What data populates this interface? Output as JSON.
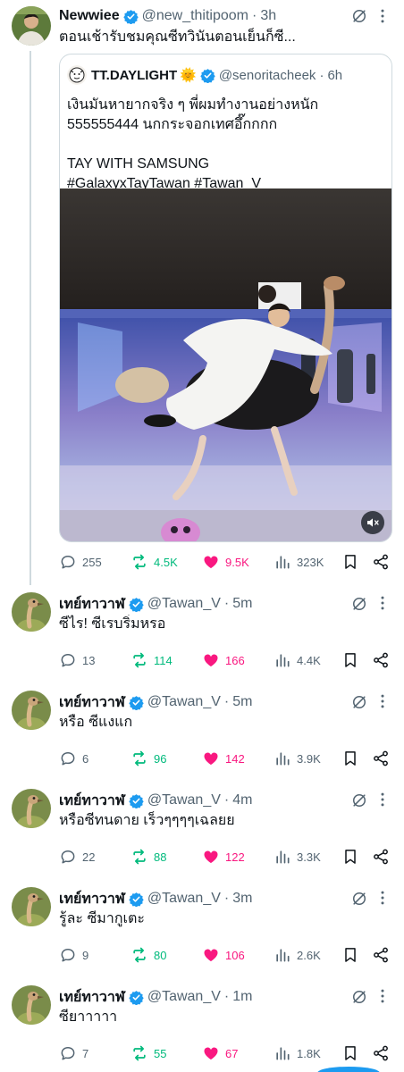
{
  "colors": {
    "accent": "#1d9bf0",
    "retweet": "#00ba7c",
    "like": "#f91880",
    "muted": "#536471",
    "thread_line": "#cfd9de"
  },
  "main_tweet": {
    "name": "Newwiee",
    "handle": "@new_thitipoom",
    "time": "3h",
    "text": "ตอนเช้ารับชมคุณซีทวินันตอนเย็นก็ซี...",
    "stats": {
      "replies": "255",
      "retweets": "4.5K",
      "likes": "9.5K",
      "views": "323K"
    },
    "quote": {
      "name": "TT.DAYLIGHT",
      "emoji": "🌞",
      "handle": "@senoritacheek",
      "time": "6h",
      "text_lines": [
        "เงินมันหายากจริง ๆ พี่ผมทำงานอย่างหนัก",
        "555555444 นกกระจอกเทศอึ๊กกกก",
        "",
        "TAY WITH SAMSUNG",
        "#GalaxyxTayTawan #Tawan_V"
      ],
      "media_icon": "speaker-muted-icon"
    }
  },
  "replies": [
    {
      "name": "เทย์ทาวาฬ",
      "handle": "@Tawan_V",
      "time": "5m",
      "text": "ซีไร! ซีเรบริ่มหรอ",
      "stats": {
        "replies": "13",
        "retweets": "114",
        "likes": "166",
        "views": "4.4K"
      }
    },
    {
      "name": "เทย์ทาวาฬ",
      "handle": "@Tawan_V",
      "time": "5m",
      "text": "หรือ ซีแงแก",
      "stats": {
        "replies": "6",
        "retweets": "96",
        "likes": "142",
        "views": "3.9K"
      }
    },
    {
      "name": "เทย์ทาวาฬ",
      "handle": "@Tawan_V",
      "time": "4m",
      "text": "หรือซีทนดาย เร็วๆๆๆๆเฉลยย",
      "stats": {
        "replies": "22",
        "retweets": "88",
        "likes": "122",
        "views": "3.3K"
      }
    },
    {
      "name": "เทย์ทาวาฬ",
      "handle": "@Tawan_V",
      "time": "3m",
      "text": "รู้ละ ซีมากูเตะ",
      "stats": {
        "replies": "9",
        "retweets": "80",
        "likes": "106",
        "views": "2.6K"
      }
    },
    {
      "name": "เทย์ทาวาฬ",
      "handle": "@Tawan_V",
      "time": "1m",
      "text": "ซียาาาาา",
      "stats": {
        "replies": "7",
        "retweets": "55",
        "likes": "67",
        "views": "1.8K"
      }
    }
  ],
  "separator": "·"
}
